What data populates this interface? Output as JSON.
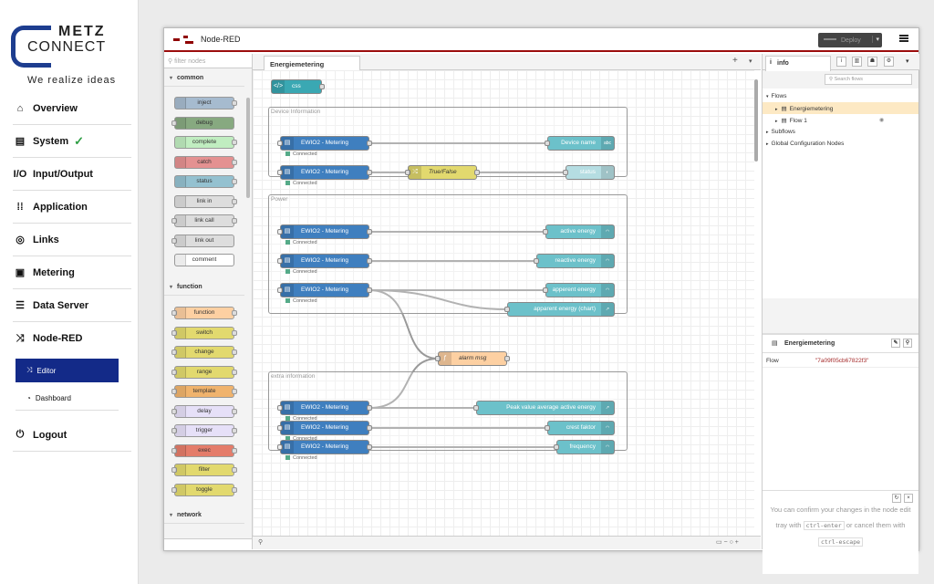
{
  "portal": {
    "brand_top": "METZ",
    "brand_bottom": "CONNECT",
    "tagline": "We realize ideas",
    "nav": [
      {
        "label": "Overview",
        "icon": "home-icon"
      },
      {
        "label": "System",
        "icon": "router-icon",
        "status": "check-icon"
      },
      {
        "label": "Input/Output",
        "icon": "io-icon"
      },
      {
        "label": "Application",
        "icon": "apps-grid-icon"
      },
      {
        "label": "Links",
        "icon": "globe-icon"
      },
      {
        "label": "Metering",
        "icon": "meter-icon"
      },
      {
        "label": "Data Server",
        "icon": "database-icon"
      },
      {
        "label": "Node-RED",
        "icon": "node-red-icon"
      },
      {
        "label": "Logout",
        "icon": "power-icon"
      }
    ],
    "subnav": [
      {
        "label": "Editor",
        "icon": "node-red-icon",
        "active": true
      },
      {
        "label": "Dashboard",
        "icon": "gauge-icon",
        "active": false
      }
    ]
  },
  "nodered": {
    "title": "Node-RED",
    "deploy_label": "Deploy",
    "palette": {
      "filter_placeholder": "filter nodes",
      "categories": [
        {
          "name": "common",
          "nodes": [
            {
              "label": "inject",
              "color": "#a6bbcf"
            },
            {
              "label": "debug",
              "color": "#87a980"
            },
            {
              "label": "complete",
              "color": "#c0edc0"
            },
            {
              "label": "catch",
              "color": "#e49191"
            },
            {
              "label": "status",
              "color": "#94c1d0"
            },
            {
              "label": "link in",
              "color": "#dddddd"
            },
            {
              "label": "link call",
              "color": "#dddddd"
            },
            {
              "label": "link out",
              "color": "#dddddd"
            },
            {
              "label": "comment",
              "color": "#ffffff"
            }
          ]
        },
        {
          "name": "function",
          "nodes": [
            {
              "label": "function",
              "color": "#fdd0a2"
            },
            {
              "label": "switch",
              "color": "#e2d96e"
            },
            {
              "label": "change",
              "color": "#e2d96e"
            },
            {
              "label": "range",
              "color": "#e2d96e"
            },
            {
              "label": "template",
              "color": "#f0b36d"
            },
            {
              "label": "delay",
              "color": "#e6e0f8"
            },
            {
              "label": "trigger",
              "color": "#e6e0f8"
            },
            {
              "label": "exec",
              "color": "#e47c6a"
            },
            {
              "label": "filter",
              "color": "#e2d96e"
            },
            {
              "label": "toggle",
              "color": "#e2d96e"
            }
          ]
        },
        {
          "name": "network",
          "nodes": []
        }
      ]
    },
    "workspace": {
      "tab": "Energiemetering",
      "css_node": "css",
      "groups": [
        {
          "label": "Device Information"
        },
        {
          "label": "Power"
        },
        {
          "label": "extra information"
        }
      ],
      "sources": [
        {
          "label": "EWIO2 - Metering",
          "status": "Connected"
        },
        {
          "label": "EWIO2 - Metering",
          "status": "Connected"
        },
        {
          "label": "EWIO2 - Metering",
          "status": "Connected"
        },
        {
          "label": "EWIO2 - Metering",
          "status": "Connected"
        },
        {
          "label": "EWIO2 - Metering",
          "status": "Connected"
        },
        {
          "label": "EWIO2 - Metering",
          "status": "Connected"
        },
        {
          "label": "EWIO2 - Metering",
          "status": "Connected"
        },
        {
          "label": "EWIO2 - Metering",
          "status": "Connected"
        }
      ],
      "switch_node": "True/False",
      "function_node": "alarm msg",
      "outputs": [
        {
          "label": "Device name",
          "icon": "abc"
        },
        {
          "label": "status",
          "icon": "toggle-icon"
        },
        {
          "label": "active energy",
          "icon": "gauge-icon"
        },
        {
          "label": "reactive energy",
          "icon": "gauge-icon"
        },
        {
          "label": "apperent energy",
          "icon": "gauge-icon"
        },
        {
          "label": "apparent energy (chart)",
          "icon": "chart-icon"
        },
        {
          "label": "Peak value average active energy",
          "icon": "chart-icon"
        },
        {
          "label": "crest faktor",
          "icon": "gauge-icon"
        },
        {
          "label": "frequency",
          "icon": "gauge-icon"
        }
      ]
    },
    "sidebar": {
      "tab": "info",
      "search_placeholder": "Search flows",
      "tree": [
        {
          "label": "Flows"
        },
        {
          "label": "Energiemetering",
          "selected": true
        },
        {
          "label": "Flow 1"
        },
        {
          "label": "Subflows"
        },
        {
          "label": "Global Configuration Nodes"
        }
      ],
      "props_title": "Energiemetering",
      "prop_key": "Flow",
      "prop_value": "\"7a09f05cb67822f3\"",
      "tip_text_1": "You can confirm your changes in the node edit tray with",
      "tip_key_1": "ctrl-enter",
      "tip_text_2": "or cancel them with",
      "tip_key_2": "ctrl-escape"
    }
  }
}
